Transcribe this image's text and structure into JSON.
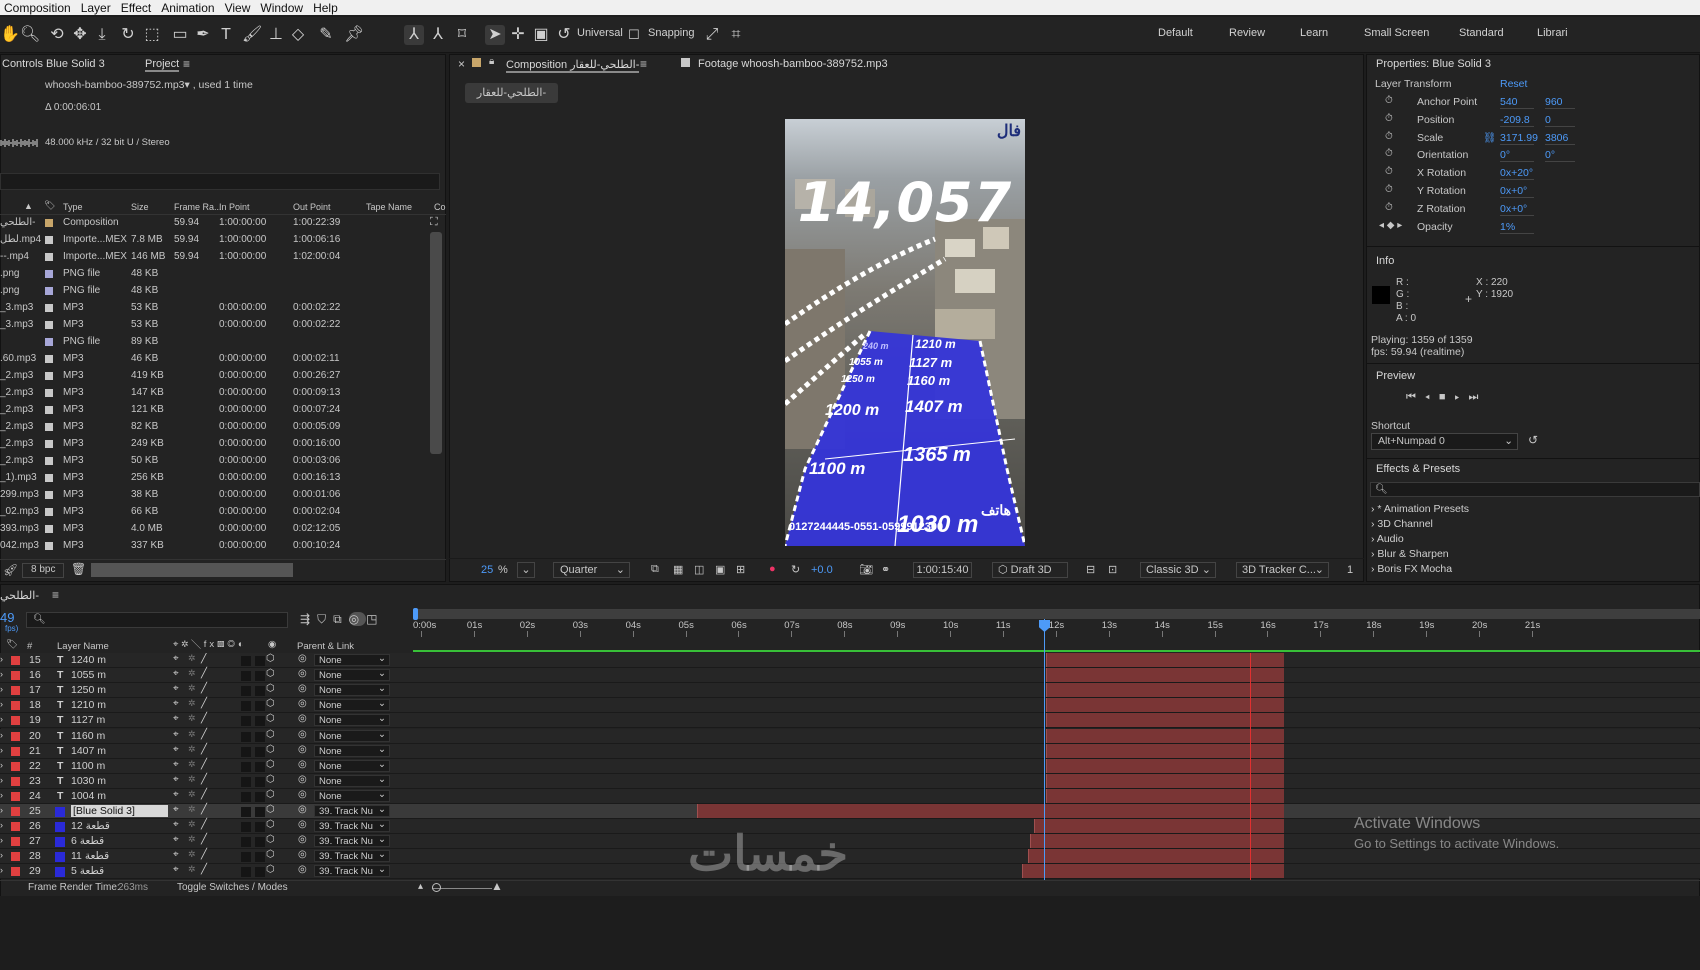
{
  "menu": [
    "Composition",
    "Layer",
    "Effect",
    "Animation",
    "View",
    "Window",
    "Help"
  ],
  "toolbar": {
    "universal": "Universal",
    "snapping": "Snapping",
    "workspaces": [
      "Default",
      "Review",
      "Learn",
      "Small Screen",
      "Standard",
      "Librari"
    ]
  },
  "project": {
    "tab_controls": "Controls Blue Solid 3",
    "tab_project": "Project",
    "file": "whoosh-bamboo-389752.mp3▾ , used 1 time",
    "duration": "Δ 0:00:06:01",
    "audio": "48.000 kHz / 32 bit U / Stereo",
    "headers": [
      "Type",
      "Size",
      "Frame Ra...",
      "In Point",
      "Out Point",
      "Tape Name",
      "Co"
    ],
    "rows": [
      [
        "الطلحي-",
        "#c8a66a",
        "Composition",
        "",
        "59.94",
        "1:00:00:00",
        "1:00:22:39"
      ],
      [
        "لطل.mp4",
        "#c8c8c8",
        "Importe...MEX",
        "7.8 MB",
        "59.94",
        "1:00:00:00",
        "1:00:06:16"
      ],
      [
        "--.mp4",
        "#c8c8c8",
        "Importe...MEX",
        "146 MB",
        "59.94",
        "1:00:00:00",
        "1:02:00:04"
      ],
      [
        ".png",
        "#a7a7d8",
        "PNG file",
        "48 KB",
        "",
        "",
        ""
      ],
      [
        ".png",
        "#a7a7d8",
        "PNG file",
        "48 KB",
        "",
        "",
        ""
      ],
      [
        "_3.mp3",
        "#c8c8c8",
        "MP3",
        "53 KB",
        "",
        "0:00:00:00",
        "0:00:02:22"
      ],
      [
        "_3.mp3",
        "#c8c8c8",
        "MP3",
        "53 KB",
        "",
        "0:00:00:00",
        "0:00:02:22"
      ],
      [
        "",
        "#a7a7d8",
        "PNG file",
        "89 KB",
        "",
        "",
        ""
      ],
      [
        ".60.mp3",
        "#c8c8c8",
        "MP3",
        "46 KB",
        "",
        "0:00:00:00",
        "0:00:02:11"
      ],
      [
        "_2.mp3",
        "#c8c8c8",
        "MP3",
        "419 KB",
        "",
        "0:00:00:00",
        "0:00:26:27"
      ],
      [
        "_2.mp3",
        "#c8c8c8",
        "MP3",
        "147 KB",
        "",
        "0:00:00:00",
        "0:00:09:13"
      ],
      [
        "_2.mp3",
        "#c8c8c8",
        "MP3",
        "121 KB",
        "",
        "0:00:00:00",
        "0:00:07:24"
      ],
      [
        "_2.mp3",
        "#c8c8c8",
        "MP3",
        "82 KB",
        "",
        "0:00:00:00",
        "0:00:05:09"
      ],
      [
        "_2.mp3",
        "#c8c8c8",
        "MP3",
        "249 KB",
        "",
        "0:00:00:00",
        "0:00:16:00"
      ],
      [
        "_2.mp3",
        "#c8c8c8",
        "MP3",
        "50 KB",
        "",
        "0:00:00:00",
        "0:00:03:06"
      ],
      [
        "_1).mp3",
        "#c8c8c8",
        "MP3",
        "256 KB",
        "",
        "0:00:00:00",
        "0:00:16:13"
      ],
      [
        "299.mp3",
        "#c8c8c8",
        "MP3",
        "38 KB",
        "",
        "0:00:00:00",
        "0:00:01:06"
      ],
      [
        "_02.mp3",
        "#c8c8c8",
        "MP3",
        "66 KB",
        "",
        "0:00:00:00",
        "0:00:02:04"
      ],
      [
        "393.mp3",
        "#c8c8c8",
        "MP3",
        "4.0 MB",
        "",
        "0:00:00:00",
        "0:02:12:05"
      ],
      [
        "042.mp3",
        "#c8c8c8",
        "MP3",
        "337 KB",
        "",
        "0:00:00:00",
        "0:00:10:24"
      ]
    ],
    "bpc": "8 bpc"
  },
  "viewer": {
    "tab_comp": "Composition الطلحي-للعقار-",
    "tab_footage": "Footage whoosh-bamboo-389752.mp3",
    "comp_button": "الطلحي-للعقار-",
    "zoom": "25",
    "zoom_unit": "%",
    "resolution": "Quarter",
    "exposure": "+0.0",
    "timecode": "1:00:15:40",
    "renderer": "Draft 3D",
    "view_mode": "Classic 3D",
    "tracker": "3D Tracker C...",
    "views": "1"
  },
  "frame": {
    "big_number": "14,057",
    "logo": "فال",
    "plots": [
      "240 m",
      "1055 m",
      "1250 m",
      "1210 m",
      "1127 m",
      "1160 m",
      "1200 m",
      "1407 m",
      "1365 m",
      "1100 m",
      "1030 m"
    ],
    "phone_label": "هاتف",
    "phone": "0127244445-0551-0599912300"
  },
  "properties": {
    "title": "Properties: Blue Solid 3",
    "section": "Layer Transform",
    "reset": "Reset",
    "items": [
      [
        "Anchor Point",
        "540",
        "960"
      ],
      [
        "Position",
        "-209.8",
        "0"
      ],
      [
        "Scale",
        "3171.99",
        "3806"
      ],
      [
        "Orientation",
        "0°",
        "0°"
      ],
      [
        "X Rotation",
        "0x+20°",
        ""
      ],
      [
        "Y Rotation",
        "0x+0°",
        ""
      ],
      [
        "Z Rotation",
        "0x+0°",
        ""
      ],
      [
        "Opacity",
        "1%",
        ""
      ]
    ]
  },
  "info": {
    "title": "Info",
    "r": "R :",
    "g": "G :",
    "b": "B :",
    "a": "A :  0",
    "x": "X : 220",
    "y": "Y : 1920",
    "playing": "Playing: 1359 of 1359",
    "fps": "fps: 59.94 (realtime)"
  },
  "preview": {
    "title": "Preview",
    "shortcut_label": "Shortcut",
    "shortcut": "Alt+Numpad 0"
  },
  "effects": {
    "title": "Effects & Presets",
    "items": [
      "* Animation Presets",
      "3D Channel",
      "Audio",
      "Blur & Sharpen",
      "Boris FX Mocha"
    ]
  },
  "timeline": {
    "tab": "الطلحي-",
    "frame": "49",
    "fps_label": "fps)",
    "layer_header": "Layer Name",
    "parent_header": "Parent & Link",
    "num_header": "#",
    "ticks": [
      "0:00s",
      "01s",
      "02s",
      "03s",
      "04s",
      "05s",
      "06s",
      "07s",
      "08s",
      "09s",
      "10s",
      "11s",
      "12s",
      "13s",
      "14s",
      "15s",
      "16s",
      "17s",
      "18s",
      "19s",
      "20s",
      "21s"
    ],
    "layers": [
      [
        "15",
        "T",
        "1240 m",
        "None"
      ],
      [
        "16",
        "T",
        "1055 m",
        "None"
      ],
      [
        "17",
        "T",
        "1250 m",
        "None"
      ],
      [
        "18",
        "T",
        "1210 m",
        "None"
      ],
      [
        "19",
        "T",
        "1127 m",
        "None"
      ],
      [
        "20",
        "T",
        "1160 m",
        "None"
      ],
      [
        "21",
        "T",
        "1407 m",
        "None"
      ],
      [
        "22",
        "T",
        "1100 m",
        "None"
      ],
      [
        "23",
        "T",
        "1030 m",
        "None"
      ],
      [
        "24",
        "T",
        "1004 m",
        "None"
      ],
      [
        "25",
        "",
        "[Blue Solid 3]",
        "39. Track Nu"
      ],
      [
        "26",
        "",
        "12 قطعة",
        "39. Track Nu"
      ],
      [
        "27",
        "",
        "6 قطعة",
        "39. Track Nu"
      ],
      [
        "28",
        "",
        "11 قطعة",
        "39. Track Nu"
      ],
      [
        "29",
        "",
        "5 قطعة",
        "39. Track Nu"
      ]
    ],
    "render_time_label": "Frame Render Time:",
    "render_time": "263ms",
    "toggle": "Toggle Switches / Modes"
  },
  "watermark": {
    "activate": "Activate Windows",
    "goto": "Go to Settings to activate Windows.",
    "logo": "خمسات"
  },
  "colors": {
    "accent": "#4d9af8",
    "layer_bar": "#7a3535",
    "playhead": "#4d9af8",
    "label_red": "#e04040",
    "blue_solid": "#3535d8"
  }
}
